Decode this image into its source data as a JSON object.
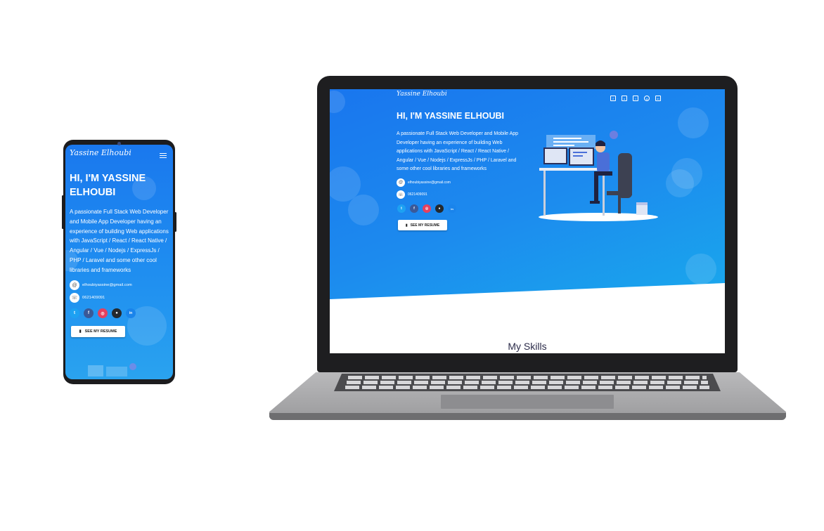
{
  "brand": {
    "logo": "Yassine Elhoubi"
  },
  "hero": {
    "title": "HI, I'M YASSINE ELHOUBI",
    "description": "A passionate Full Stack Web Developer and Mobile App Developer having an experience of building Web applications with JavaScript / React / React Native / Angular / Vue / Nodejs / ExpressJs / PHP / Laravel and some other cool libraries and frameworks",
    "email": "elhoubiyassine@gmail.com",
    "phone": "0621409091",
    "resume_button": "SEE MY RESUME"
  },
  "social": [
    {
      "icon": "twitter-icon",
      "glyph": "t",
      "color": "#1da1f2"
    },
    {
      "icon": "facebook-icon",
      "glyph": "f",
      "color": "#3b5998"
    },
    {
      "icon": "instagram-icon",
      "glyph": "◎",
      "color": "#e4405f"
    },
    {
      "icon": "github-icon",
      "glyph": "●",
      "color": "#24292e"
    },
    {
      "icon": "linkedin-icon",
      "glyph": "in",
      "color": "#1a84eb"
    }
  ],
  "sections": {
    "skills_heading": "My Skills"
  },
  "colors": {
    "gradient_start": "#1976ee",
    "gradient_end": "#19b1ec",
    "background": "#ffffff"
  }
}
